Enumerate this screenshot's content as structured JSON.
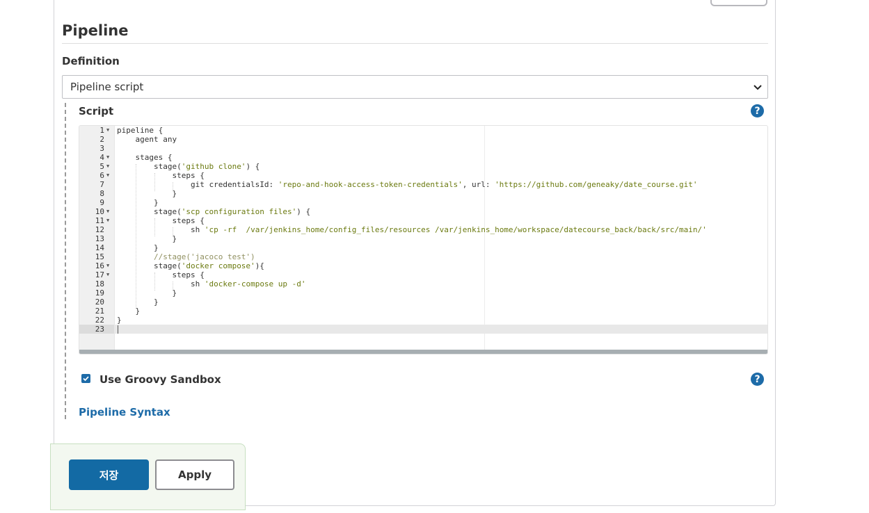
{
  "section": {
    "title": "Pipeline"
  },
  "definition": {
    "label": "Definition",
    "selected": "Pipeline script"
  },
  "script": {
    "label": "Script",
    "help": "?",
    "lines": [
      {
        "n": "1",
        "fold": true,
        "segs": [
          {
            "t": "pipeline {",
            "c": "plain"
          }
        ]
      },
      {
        "n": "2",
        "fold": false,
        "segs": [
          {
            "t": "    agent any",
            "c": "plain"
          }
        ]
      },
      {
        "n": "3",
        "fold": false,
        "segs": []
      },
      {
        "n": "4",
        "fold": true,
        "segs": [
          {
            "t": "    stages {",
            "c": "plain"
          }
        ]
      },
      {
        "n": "5",
        "fold": true,
        "segs": [
          {
            "t": "        stage(",
            "c": "plain"
          },
          {
            "t": "'github clone'",
            "c": "str"
          },
          {
            "t": ") {",
            "c": "plain"
          }
        ]
      },
      {
        "n": "6",
        "fold": true,
        "segs": [
          {
            "t": "            steps {",
            "c": "plain"
          }
        ]
      },
      {
        "n": "7",
        "fold": false,
        "segs": [
          {
            "t": "                git credentialsId: ",
            "c": "plain"
          },
          {
            "t": "'repo-and-hook-access-token-credentials'",
            "c": "str"
          },
          {
            "t": ", url: ",
            "c": "plain"
          },
          {
            "t": "'https://github.com/geneaky/date_course.git'",
            "c": "str"
          }
        ]
      },
      {
        "n": "8",
        "fold": false,
        "segs": [
          {
            "t": "            }",
            "c": "plain"
          }
        ]
      },
      {
        "n": "9",
        "fold": false,
        "segs": [
          {
            "t": "        }",
            "c": "plain"
          }
        ]
      },
      {
        "n": "10",
        "fold": true,
        "segs": [
          {
            "t": "        stage(",
            "c": "plain"
          },
          {
            "t": "'scp configuration files'",
            "c": "str"
          },
          {
            "t": ") {",
            "c": "plain"
          }
        ]
      },
      {
        "n": "11",
        "fold": true,
        "segs": [
          {
            "t": "            steps {",
            "c": "plain"
          }
        ]
      },
      {
        "n": "12",
        "fold": false,
        "segs": [
          {
            "t": "                sh ",
            "c": "plain"
          },
          {
            "t": "'cp -rf  /var/jenkins_home/config_files/resources /var/jenkins_home/workspace/datecourse_back/back/src/main/'",
            "c": "str"
          }
        ]
      },
      {
        "n": "13",
        "fold": false,
        "segs": [
          {
            "t": "            }",
            "c": "plain"
          }
        ]
      },
      {
        "n": "14",
        "fold": false,
        "segs": [
          {
            "t": "        }",
            "c": "plain"
          }
        ]
      },
      {
        "n": "15",
        "fold": false,
        "segs": [
          {
            "t": "        //stage('jacoco test')",
            "c": "cmt"
          }
        ]
      },
      {
        "n": "16",
        "fold": true,
        "segs": [
          {
            "t": "        stage(",
            "c": "plain"
          },
          {
            "t": "'docker compose'",
            "c": "str"
          },
          {
            "t": "){",
            "c": "plain"
          }
        ]
      },
      {
        "n": "17",
        "fold": true,
        "segs": [
          {
            "t": "            steps {",
            "c": "plain"
          }
        ]
      },
      {
        "n": "18",
        "fold": false,
        "segs": [
          {
            "t": "                sh ",
            "c": "plain"
          },
          {
            "t": "'docker-compose up -d'",
            "c": "str"
          }
        ]
      },
      {
        "n": "19",
        "fold": false,
        "segs": [
          {
            "t": "            }",
            "c": "plain"
          }
        ]
      },
      {
        "n": "20",
        "fold": false,
        "segs": [
          {
            "t": "        }",
            "c": "plain"
          }
        ]
      },
      {
        "n": "21",
        "fold": false,
        "segs": [
          {
            "t": "    }",
            "c": "plain"
          }
        ]
      },
      {
        "n": "22",
        "fold": false,
        "segs": [
          {
            "t": "}",
            "c": "plain"
          }
        ]
      },
      {
        "n": "23",
        "fold": false,
        "segs": []
      }
    ]
  },
  "sandbox": {
    "label": "Use Groovy Sandbox",
    "checked": true,
    "help": "?"
  },
  "pipeline_syntax_link": "Pipeline Syntax",
  "buttons": {
    "save": "저장",
    "apply": "Apply"
  },
  "colors": {
    "accent": "#1d6ba8",
    "string": "#6b7a10",
    "comment": "#909060"
  }
}
